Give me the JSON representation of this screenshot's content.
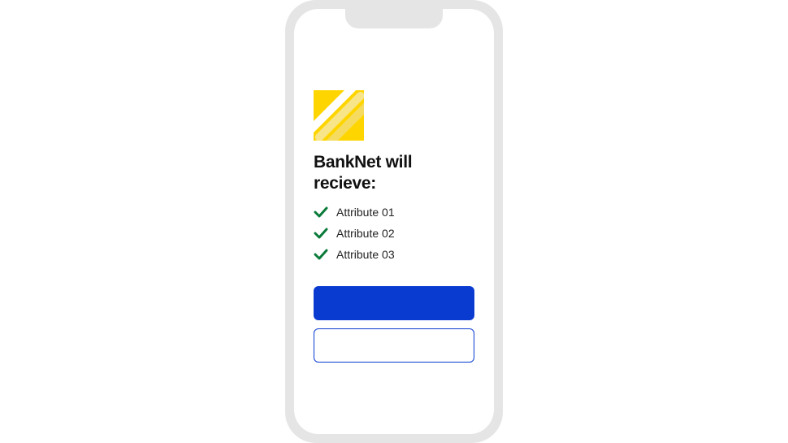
{
  "heading": "BankNet will recieve:",
  "attributes": [
    "Attribute 01",
    "Attribute 02",
    "Attribute 03"
  ],
  "buttons": {
    "primary": "",
    "secondary": ""
  },
  "colors": {
    "accent": "#0a3bd1",
    "icon_bg": "#ffd500",
    "check": "#0a7a3a"
  }
}
